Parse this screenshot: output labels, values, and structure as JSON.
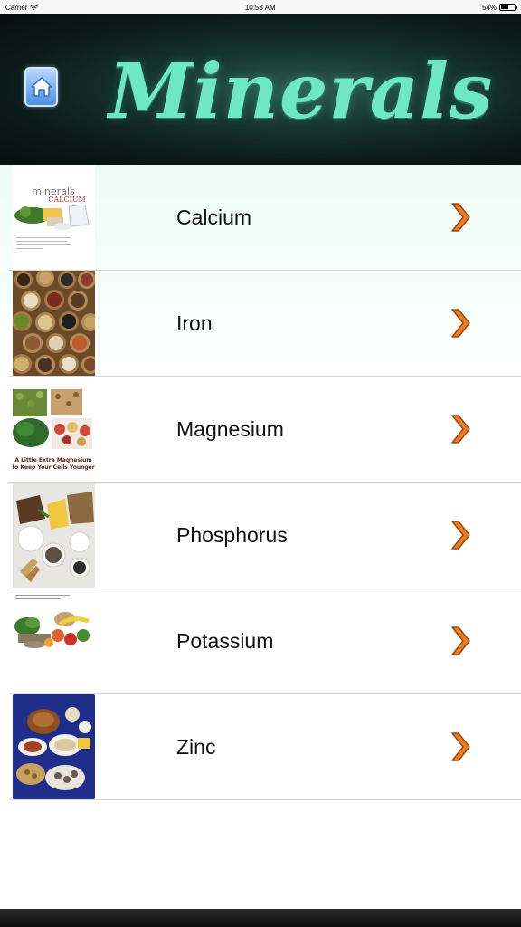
{
  "status_bar": {
    "carrier": "Carrier",
    "time": "10:53 AM",
    "battery": "54%"
  },
  "header": {
    "title": "Minerals",
    "home_icon": "home-icon"
  },
  "minerals": [
    {
      "name": "Calcium",
      "thumb_caption_title": "minerals",
      "thumb_caption_sub": "CALCIUM"
    },
    {
      "name": "Iron"
    },
    {
      "name": "Magnesium",
      "thumb_caption": "A Little Extra Magnesium to Keep Your Cells Younger"
    },
    {
      "name": "Phosphorus"
    },
    {
      "name": "Potassium"
    },
    {
      "name": "Zinc"
    }
  ],
  "colors": {
    "title": "#6ee8c4",
    "chevron": "#f07c1e",
    "header_bg": "#173631"
  }
}
